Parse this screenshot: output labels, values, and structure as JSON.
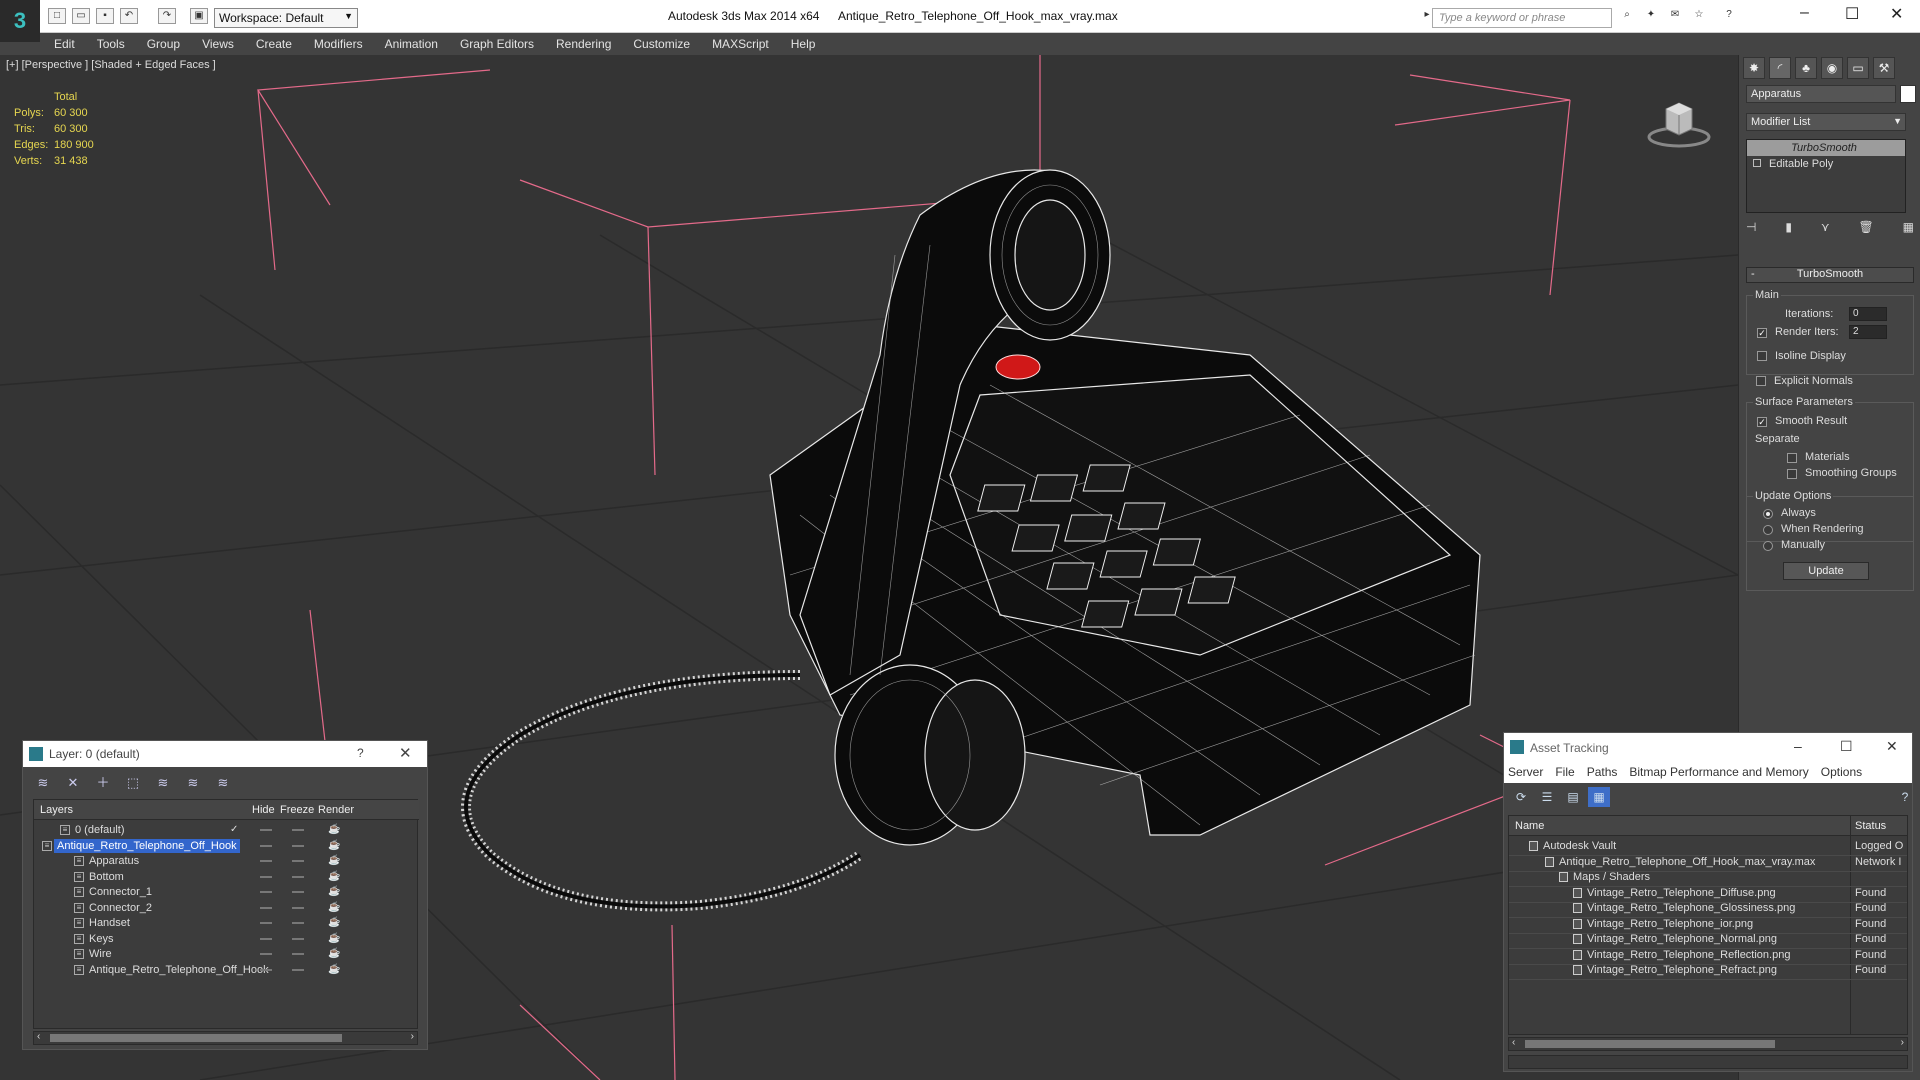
{
  "titlebar": {
    "workspace": "Workspace: Default",
    "app_title": "Autodesk 3ds Max  2014 x64",
    "file_name": "Antique_Retro_Telephone_Off_Hook_max_vray.max",
    "search_placeholder": "Type a keyword or phrase"
  },
  "menu": [
    "Edit",
    "Tools",
    "Group",
    "Views",
    "Create",
    "Modifiers",
    "Animation",
    "Graph Editors",
    "Rendering",
    "Customize",
    "MAXScript",
    "Help"
  ],
  "viewport": {
    "label": "[+] [Perspective ] [Shaded + Edged Faces ]",
    "stats_header": "Total",
    "stats": [
      {
        "k": "Polys:",
        "v": "60 300"
      },
      {
        "k": "Tris:",
        "v": "60 300"
      },
      {
        "k": "Edges:",
        "v": "180 900"
      },
      {
        "k": "Verts:",
        "v": "31 438"
      }
    ]
  },
  "command_panel": {
    "object_name": "Apparatus",
    "modifier_list": "Modifier List",
    "stack": [
      "TurboSmooth",
      "Editable Poly"
    ],
    "rollout_title": "TurboSmooth",
    "main_group": "Main",
    "iterations_label": "Iterations:",
    "iterations_value": "0",
    "render_iters_label": "Render Iters:",
    "render_iters_value": "2",
    "isoline": "Isoline Display",
    "explicit_normals": "Explicit Normals",
    "surface_group": "Surface Parameters",
    "smooth_result": "Smooth Result",
    "separate": "Separate",
    "materials": "Materials",
    "smoothing_groups": "Smoothing Groups",
    "update_group": "Update Options",
    "always": "Always",
    "when_rendering": "When Rendering",
    "manually": "Manually",
    "update_button": "Update"
  },
  "layer_dialog": {
    "title": "Layer: 0 (default)",
    "help": "?",
    "columns": [
      "Layers",
      "Hide",
      "Freeze",
      "Render"
    ],
    "rows": [
      {
        "name": "0 (default)",
        "indent": 1,
        "checked": true,
        "selected": false
      },
      {
        "name": "Antique_Retro_Telephone_Off_Hook",
        "indent": 0,
        "checked": false,
        "selected": true
      },
      {
        "name": "Apparatus",
        "indent": 2,
        "checked": false,
        "selected": false
      },
      {
        "name": "Bottom",
        "indent": 2,
        "checked": false,
        "selected": false
      },
      {
        "name": "Connector_1",
        "indent": 2,
        "checked": false,
        "selected": false
      },
      {
        "name": "Connector_2",
        "indent": 2,
        "checked": false,
        "selected": false
      },
      {
        "name": "Handset",
        "indent": 2,
        "checked": false,
        "selected": false
      },
      {
        "name": "Keys",
        "indent": 2,
        "checked": false,
        "selected": false
      },
      {
        "name": "Wire",
        "indent": 2,
        "checked": false,
        "selected": false
      },
      {
        "name": "Antique_Retro_Telephone_Off_Hook",
        "indent": 2,
        "checked": false,
        "selected": false
      }
    ]
  },
  "asset_dialog": {
    "title": "Asset Tracking",
    "menu": [
      "Server",
      "File",
      "Paths",
      "Bitmap Performance and Memory",
      "Options"
    ],
    "columns": [
      "Name",
      "Status"
    ],
    "rows": [
      {
        "name": "Autodesk Vault",
        "status": "Logged O",
        "indent": 1
      },
      {
        "name": "Antique_Retro_Telephone_Off_Hook_max_vray.max",
        "status": "Network I",
        "indent": 2
      },
      {
        "name": "Maps / Shaders",
        "status": "",
        "indent": 3
      },
      {
        "name": "Vintage_Retro_Telephone_Diffuse.png",
        "status": "Found",
        "indent": 4
      },
      {
        "name": "Vintage_Retro_Telephone_Glossiness.png",
        "status": "Found",
        "indent": 4
      },
      {
        "name": "Vintage_Retro_Telephone_ior.png",
        "status": "Found",
        "indent": 4
      },
      {
        "name": "Vintage_Retro_Telephone_Normal.png",
        "status": "Found",
        "indent": 4
      },
      {
        "name": "Vintage_Retro_Telephone_Reflection.png",
        "status": "Found",
        "indent": 4
      },
      {
        "name": "Vintage_Retro_Telephone_Refract.png",
        "status": "Found",
        "indent": 4
      }
    ]
  },
  "colors": {
    "viewport_bg": "#343434",
    "stats_yellow": "#e6d650",
    "selection_blue": "#3366cc",
    "wire_pink": "#e46a8a"
  }
}
